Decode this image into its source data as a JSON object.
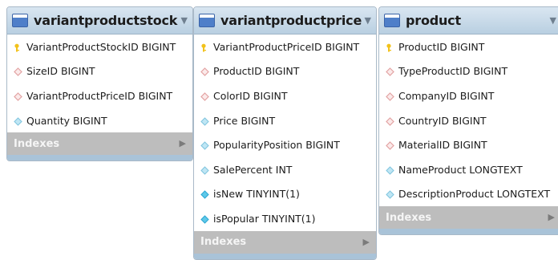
{
  "colors": {
    "primary_key": "#f2c21b",
    "foreign_key": "#e3a3a3",
    "not_null": "#5ec8e8",
    "nullable": "#bfe6f4"
  },
  "tables": [
    {
      "name": "variantproductstock",
      "columns": [
        {
          "text": "VariantProductStockID BIGINT",
          "icon": "primary-key-icon"
        },
        {
          "text": "SizeID BIGINT",
          "icon": "foreign-key-icon"
        },
        {
          "text": "VariantProductPriceID BIGINT",
          "icon": "foreign-key-icon"
        },
        {
          "text": "Quantity BIGINT",
          "icon": "nullable-column-icon"
        }
      ],
      "indexes_label": "Indexes"
    },
    {
      "name": "variantproductprice",
      "columns": [
        {
          "text": "VariantProductPriceID BIGINT",
          "icon": "primary-key-icon"
        },
        {
          "text": "ProductID BIGINT",
          "icon": "foreign-key-icon"
        },
        {
          "text": "ColorID BIGINT",
          "icon": "foreign-key-icon"
        },
        {
          "text": "Price BIGINT",
          "icon": "nullable-column-icon"
        },
        {
          "text": "PopularityPosition BIGINT",
          "icon": "nullable-column-icon"
        },
        {
          "text": "SalePercent INT",
          "icon": "nullable-column-icon"
        },
        {
          "text": "isNew TINYINT(1)",
          "icon": "not-null-column-icon"
        },
        {
          "text": "isPopular TINYINT(1)",
          "icon": "not-null-column-icon"
        }
      ],
      "indexes_label": "Indexes"
    },
    {
      "name": "product",
      "columns": [
        {
          "text": "ProductID BIGINT",
          "icon": "primary-key-icon"
        },
        {
          "text": "TypeProductID BIGINT",
          "icon": "foreign-key-icon"
        },
        {
          "text": "CompanyID BIGINT",
          "icon": "foreign-key-icon"
        },
        {
          "text": "CountryID BIGINT",
          "icon": "foreign-key-icon"
        },
        {
          "text": "MaterialID BIGINT",
          "icon": "foreign-key-icon"
        },
        {
          "text": "NameProduct LONGTEXT",
          "icon": "nullable-column-icon"
        },
        {
          "text": "DescriptionProduct LONGTEXT",
          "icon": "nullable-column-icon"
        }
      ],
      "indexes_label": "Indexes"
    }
  ]
}
